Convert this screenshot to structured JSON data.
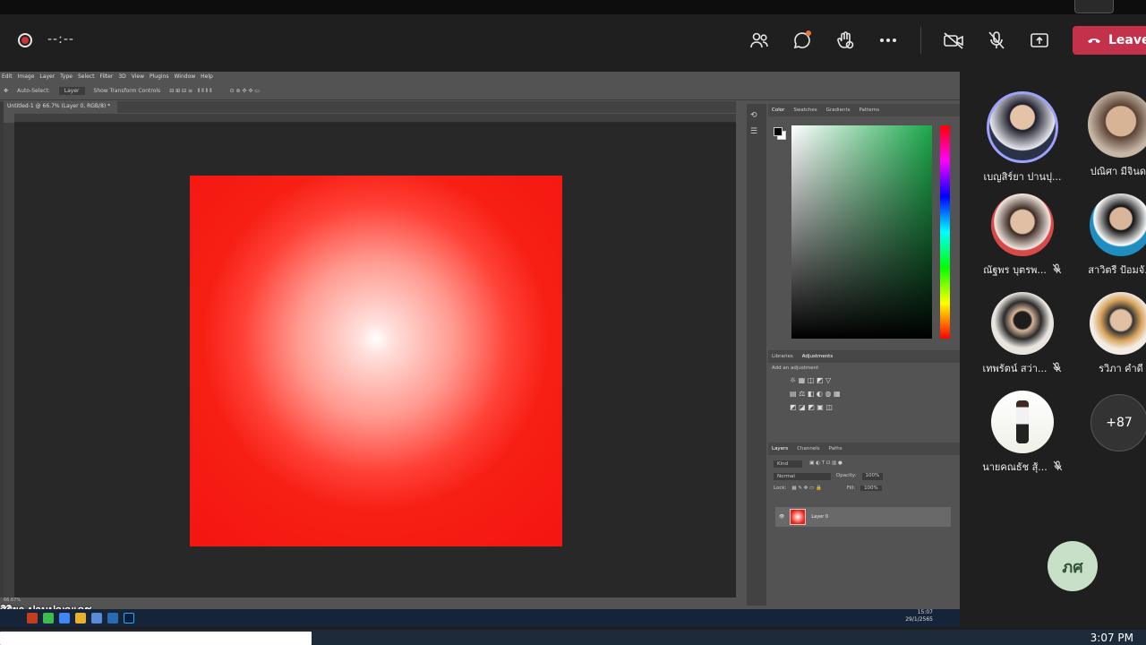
{
  "teams": {
    "timer": "--:--",
    "leave_label": "Leave",
    "icons": [
      "people-icon",
      "chat-icon",
      "raise-hand-icon",
      "more-icon",
      "camera-off-icon",
      "mic-off-icon",
      "share-icon"
    ]
  },
  "photoshop": {
    "menu": [
      "Edit",
      "Image",
      "Layer",
      "Type",
      "Select",
      "Filter",
      "3D",
      "View",
      "Plugins",
      "Window",
      "Help"
    ],
    "options": {
      "auto_select": "Auto-Select:",
      "layer_dropdown": "Layer",
      "show_transform": "Show Transform Controls",
      "mode_3d": "3D Mode:"
    },
    "doc_tab": "Untitled-1 @ 66.7% (Layer 0, RGB/8) *",
    "color_tabs": [
      "Color",
      "Swatches",
      "Gradients",
      "Patterns"
    ],
    "adj_tabs": [
      "Libraries",
      "Adjustments"
    ],
    "adj_label": "Add an adjustment",
    "layer_tabs": [
      "Layers",
      "Channels",
      "Paths"
    ],
    "kind_label": "Kind",
    "blend_mode": "Normal",
    "opacity_label": "Opacity:",
    "opacity_value": "100%",
    "lock_label": "Lock:",
    "fill_label": "Fill:",
    "fill_value": "100%",
    "layer_name": "Layer 0",
    "status": "66.67%",
    "caption": "สิริยา ปานปุญญเดช",
    "share_clock_time": "15:07",
    "share_clock_date": "29/1/2565"
  },
  "participants": [
    {
      "name": "เบญสิร์ยา ปานปุ...",
      "muted": false
    },
    {
      "name": "ปณิศา มีจินดา",
      "muted": false
    },
    {
      "name": "ณัฐพร บุตรพ...",
      "muted": true
    },
    {
      "name": "สาวิตรี ป้อมจั...",
      "muted": false
    },
    {
      "name": "เทพรัตน์ สว่า...",
      "muted": true
    },
    {
      "name": "รวิภา คำดี",
      "muted": false
    },
    {
      "name": "นายคณธัช สุ้...",
      "muted": true
    }
  ],
  "more_count": "+87",
  "me_initials": "ภศ",
  "windows": {
    "time": "3:07 PM"
  },
  "colors": {
    "leave": "#c4314b",
    "canvas_red": "#f41510",
    "self_ring": "#9ea2ff"
  }
}
